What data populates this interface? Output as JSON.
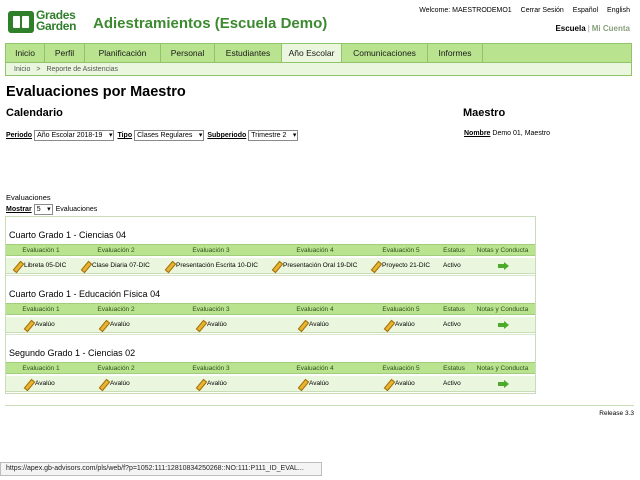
{
  "header": {
    "logo_text_1": "Grades",
    "logo_text_2": "Garden",
    "title": "Adiestramientos (Escuela Demo)",
    "topnav": [
      "Welcome: MAESTRODEMO1",
      "Cerrar Sesión",
      "Español",
      "English"
    ],
    "account": {
      "escuela": "Escuela",
      "mi_cuenta": "Mi Cuenta"
    }
  },
  "tabs": [
    {
      "label": "Inicio"
    },
    {
      "label": "Perfil"
    },
    {
      "label": "Planificación"
    },
    {
      "label": "Personal"
    },
    {
      "label": "Estudiantes"
    },
    {
      "label": "Año Escolar"
    },
    {
      "label": "Comunicaciones"
    },
    {
      "label": "Informes"
    }
  ],
  "breadcrumb": {
    "home": "Inicio",
    "arrow": ">",
    "current": "Reporte de Asistencias"
  },
  "page_title": "Evaluaciones por Maestro",
  "calendar": {
    "heading": "Calendario",
    "periodo_label": "Periodo",
    "periodo_value": "Año Escolar 2018-19",
    "tipo_label": "Tipo",
    "tipo_value": "Clases Regulares",
    "subperiodo_label": "Subperiodo",
    "subperiodo_value": "Trimestre 2"
  },
  "teacher": {
    "heading": "Maestro",
    "name_label": "Nombre",
    "name_value": "Demo 01, Maestro"
  },
  "evaluations": {
    "title": "Evaluaciones",
    "show_label": "Mostrar",
    "show_value": "5",
    "show_suffix": "Evaluaciones",
    "columns": [
      "Evaluación 1",
      "Evaluación 2",
      "Evaluación 3",
      "Evaluación 4",
      "Evaluación 5",
      "Estatus",
      "Notas y Conducta"
    ],
    "groups": [
      {
        "title": "Cuarto Grado 1 - Ciencias 04",
        "cells": [
          "Libreta 05-DIC",
          "Clase Diaria 07-DIC",
          "Presentación Escrita 10-DIC",
          "Presentación Oral 19-DIC",
          "Proyecto 21-DIC"
        ],
        "status": "Activo"
      },
      {
        "title": "Cuarto Grado 1 - Educación Física 04",
        "cells": [
          "Avalúo",
          "Avalúo",
          "Avalúo",
          "Avalúo",
          "Avalúo"
        ],
        "status": "Activo"
      },
      {
        "title": "Segundo Grado 1 - Ciencias 02",
        "cells": [
          "Avalúo",
          "Avalúo",
          "Avalúo",
          "Avalúo",
          "Avalúo"
        ],
        "status": "Activo"
      }
    ]
  },
  "release": "Release 3.3",
  "status_url": "https://apex.gb-advisors.com/pls/web/f?p=1052:111:12810834250268::NO:111:P111_ID_EVAL..."
}
